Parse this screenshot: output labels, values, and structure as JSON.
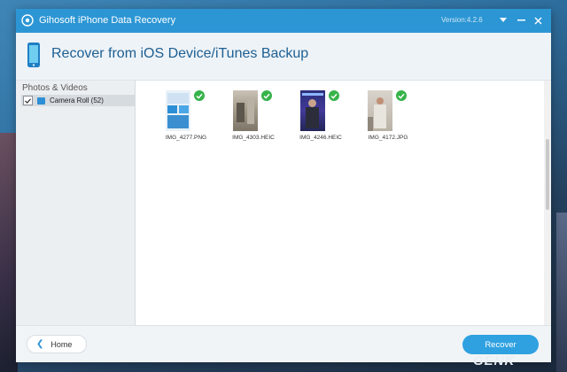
{
  "window": {
    "title": "Gihosoft iPhone Data Recovery",
    "version": "Version:4.2.6",
    "accent_color": "#2c96d4"
  },
  "header": {
    "title": "Recover from iOS Device/iTunes Backup",
    "icon": "phone-icon"
  },
  "sidebar": {
    "category": "Photos & Videos",
    "items": [
      {
        "label": "Camera Roll (52)",
        "checked": true
      }
    ]
  },
  "files": [
    {
      "name": "IMG_4277.PNG",
      "selected": true
    },
    {
      "name": "IMG_4303.HEIC",
      "selected": true
    },
    {
      "name": "IMG_4246.HEIC",
      "selected": true
    },
    {
      "name": "IMG_4172.JPG",
      "selected": true
    }
  ],
  "footer": {
    "home_label": "Home",
    "recover_label": "Recover"
  },
  "watermark": "GENK"
}
